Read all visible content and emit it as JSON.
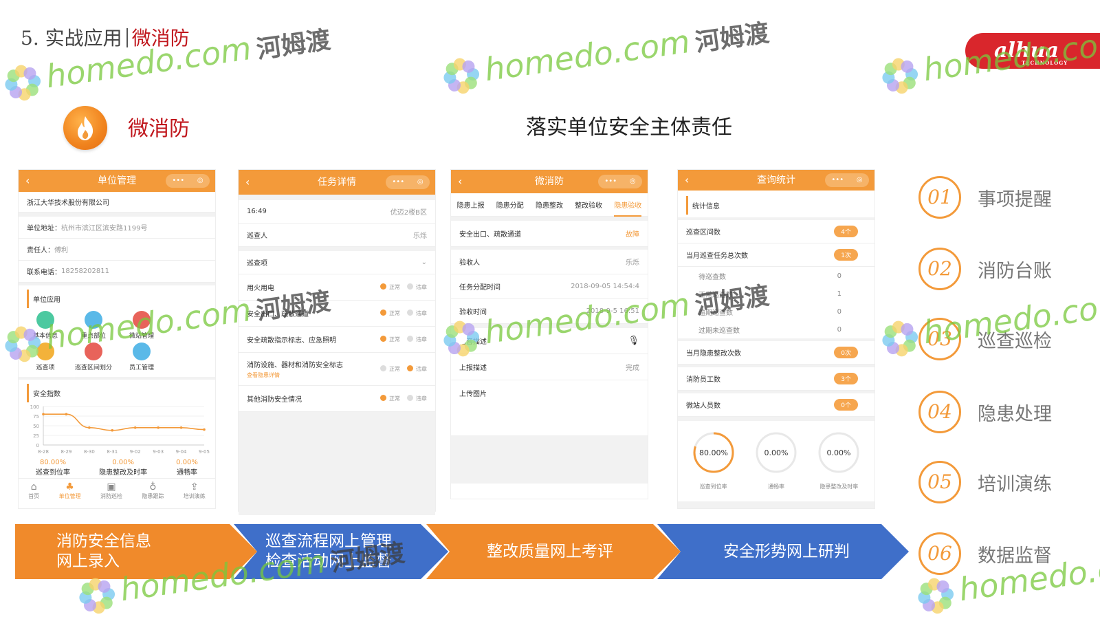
{
  "header": {
    "prefix": "5. 实战应用",
    "highlight": "微消防"
  },
  "logo": {
    "text": "alhua",
    "sub": "TECHNOLOGY"
  },
  "brand": {
    "name": "微消防"
  },
  "main_title": "落实单位安全主体责任",
  "phone1": {
    "title": "单位管理",
    "company": "浙江大华技术股份有限公司",
    "address_label": "单位地址：",
    "address": "杭州市滨江区滨安路1199号",
    "person_label": "责任人：",
    "person": "傅利",
    "phone_label": "联系电话：",
    "phone": "18258202811",
    "apps_title": "单位应用",
    "apps": [
      "基本信息",
      "重点部位",
      "微站管理",
      "巡查项",
      "巡查区间划分",
      "员工管理"
    ],
    "index_title": "安全指数",
    "y_ticks": [
      "100",
      "75",
      "50",
      "25",
      "0"
    ],
    "x_ticks": [
      "8-28",
      "8-29",
      "8-30",
      "8-31",
      "9-02",
      "9-03",
      "9-04",
      "9-05"
    ],
    "stats": [
      {
        "value": "80.00%",
        "label": "巡查到位率"
      },
      {
        "value": "0.00%",
        "label": "隐患整改及时率"
      },
      {
        "value": "0.00%",
        "label": "通畅率"
      }
    ],
    "nav": [
      "首页",
      "单位管理",
      "消防巡检",
      "隐患跟踪",
      "培训演练"
    ],
    "chart_data": {
      "type": "line",
      "categories": [
        "8-28",
        "8-29",
        "8-30",
        "8-31",
        "9-02",
        "9-03",
        "9-04",
        "9-05"
      ],
      "values": [
        80,
        80,
        45,
        38,
        45,
        45,
        45,
        40
      ],
      "ylim": [
        0,
        100
      ]
    }
  },
  "phone2": {
    "title": "任务详情",
    "time": "16:49",
    "place": "优迈2楼B区",
    "inspector_label": "巡查人",
    "inspector": "乐烁",
    "items_label": "巡查项",
    "normal": "正常",
    "violation": "违章",
    "items": [
      "用火用电",
      "安全出口、疏散通道",
      "安全疏散指示标志、应急照明",
      "消防设施、器材和消防安全标志",
      "其他消防安全情况"
    ],
    "hazard_link": "查看隐患详情"
  },
  "phone3": {
    "title": "微消防",
    "tabs": [
      "隐患上报",
      "隐患分配",
      "隐患整改",
      "整改验收",
      "隐患验收"
    ],
    "item": "安全出口、疏散通道",
    "item_status": "故障",
    "acceptor_label": "验收人",
    "acceptor": "乐烁",
    "assign_label": "任务分配时间",
    "assign": "2018-09-05 14:54:4",
    "accept_label": "验收时间",
    "accept": "2018-9-5 16:51",
    "voice_label": "语音描述",
    "report_label": "上报描述",
    "report": "完成",
    "upload_label": "上传图片"
  },
  "phone4": {
    "title": "查询统计",
    "section": "统计信息",
    "rows": [
      {
        "label": "巡查区间数",
        "value": "4个",
        "pill": true
      },
      {
        "label": "当月巡查任务总次数",
        "value": "1次",
        "pill": true
      },
      {
        "label": "待巡查数",
        "value": "0",
        "pill": false
      },
      {
        "label": "正常巡查数",
        "value": "1",
        "pill": false
      },
      {
        "label": "逾期巡查数",
        "value": "0",
        "pill": false
      },
      {
        "label": "过期未巡查数",
        "value": "0",
        "pill": false
      },
      {
        "label": "当月隐患整改次数",
        "value": "0次",
        "pill": true
      },
      {
        "label": "消防员工数",
        "value": "3个",
        "pill": true
      },
      {
        "label": "微站人员数",
        "value": "0个",
        "pill": true
      }
    ],
    "rings": [
      {
        "value": "80.00%",
        "label": "巡查到位率",
        "fraction": 0.8
      },
      {
        "value": "0.00%",
        "label": "通畅率",
        "fraction": 0
      },
      {
        "value": "0.00%",
        "label": "隐患整改及时率",
        "fraction": 0
      }
    ]
  },
  "features": [
    {
      "num": "01",
      "label": "事项提醒"
    },
    {
      "num": "02",
      "label": "消防台账"
    },
    {
      "num": "03",
      "label": "巡查巡检"
    },
    {
      "num": "04",
      "label": "隐患处理"
    },
    {
      "num": "05",
      "label": "培训演练"
    },
    {
      "num": "06",
      "label": "数据监督"
    }
  ],
  "arrows": [
    {
      "line1": "消防安全信息",
      "line2": "网上录入"
    },
    {
      "line1": "巡查流程网上管理",
      "line2": "检查活动网上监督"
    },
    {
      "line1": "整改质量网上考评",
      "line2": ""
    },
    {
      "line1": "安全形势网上研判",
      "line2": ""
    }
  ],
  "watermark": {
    "latin": "homedo.com",
    "cn": "河姆渡"
  },
  "colors": {
    "orange": "#f39a3a",
    "blue": "#3f6fc9",
    "red": "#c0161c"
  }
}
